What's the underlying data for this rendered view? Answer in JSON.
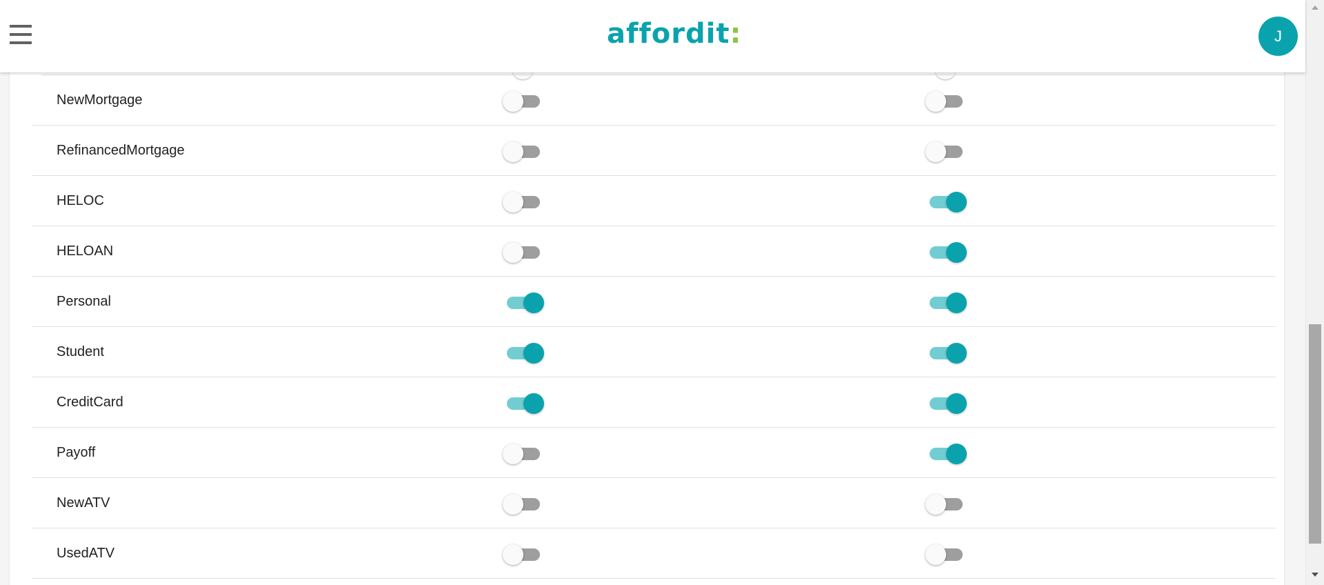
{
  "header": {
    "menu_icon": "hamburger-menu-icon",
    "logo_main": "afford",
    "logo_accent_i": "i",
    "logo_end": "t",
    "logo_colon": ":",
    "avatar_initial": "J"
  },
  "colors": {
    "brand": "#0aa3ad",
    "brand_light": "#72cdd3",
    "logo_accent": "#8cc540",
    "switch_off_track": "#9e9e9e"
  },
  "rows": [
    {
      "label": "NewMortgage",
      "col1": false,
      "col2": false
    },
    {
      "label": "RefinancedMortgage",
      "col1": false,
      "col2": false
    },
    {
      "label": "HELOC",
      "col1": false,
      "col2": true
    },
    {
      "label": "HELOAN",
      "col1": false,
      "col2": true
    },
    {
      "label": "Personal",
      "col1": true,
      "col2": true
    },
    {
      "label": "Student",
      "col1": true,
      "col2": true
    },
    {
      "label": "CreditCard",
      "col1": true,
      "col2": true
    },
    {
      "label": "Payoff",
      "col1": false,
      "col2": true
    },
    {
      "label": "NewATV",
      "col1": false,
      "col2": false
    },
    {
      "label": "UsedATV",
      "col1": false,
      "col2": false
    }
  ]
}
